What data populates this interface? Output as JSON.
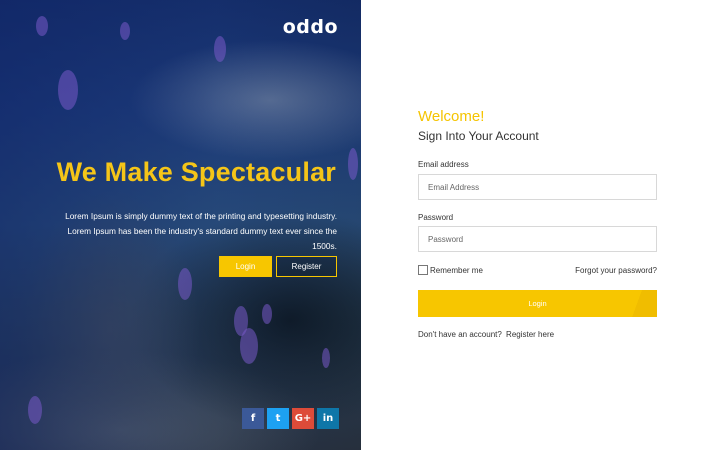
{
  "brand": {
    "logo": "oddo"
  },
  "hero": {
    "headline": "We Make Spectacular",
    "description": "Lorem Ipsum is simply dummy text of the printing and typesetting industry. Lorem Ipsum has been the industry's standard dummy text ever since the 1500s.",
    "login_label": "Login",
    "register_label": "Register",
    "accent_color": "#f7c600"
  },
  "socials": [
    {
      "name": "facebook-icon",
      "glyph": "f",
      "color": "#3b5998"
    },
    {
      "name": "twitter-icon",
      "glyph": "t",
      "color": "#1da1f2"
    },
    {
      "name": "google-plus-icon",
      "glyph": "G+",
      "color": "#dd4b39"
    },
    {
      "name": "linkedin-icon",
      "glyph": "in",
      "color": "#0e76a8"
    }
  ],
  "form": {
    "welcome": "Welcome!",
    "subtitle": "Sign Into Your Account",
    "email_label": "Email address",
    "email_placeholder": "Email Address",
    "password_label": "Password",
    "password_placeholder": "Password",
    "remember_label": "Remember me",
    "forgot_label": "Forgot your password?",
    "login_label": "Login",
    "no_account_text": "Don't have an account?",
    "register_link": "Register here"
  }
}
